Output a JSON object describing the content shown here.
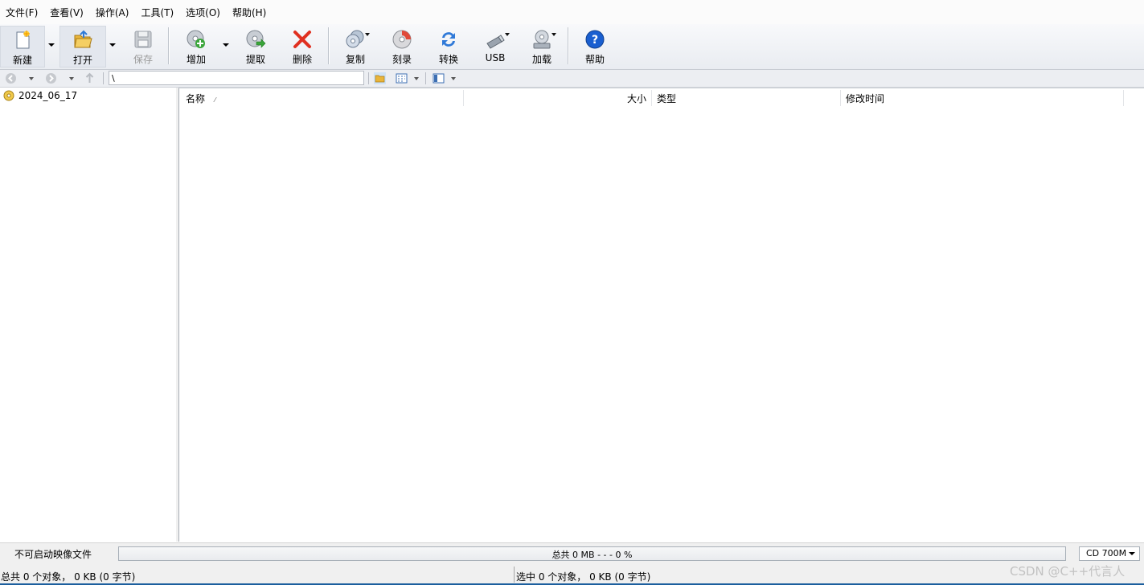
{
  "menu": [
    "文件(F)",
    "查看(V)",
    "操作(A)",
    "工具(T)",
    "选项(O)",
    "帮助(H)"
  ],
  "toolbar": {
    "new": "新建",
    "open": "打开",
    "save": "保存",
    "add": "增加",
    "extract": "提取",
    "delete": "删除",
    "copy": "复制",
    "burn": "刻录",
    "convert": "转换",
    "usb": "USB",
    "mount": "加载",
    "help": "帮助"
  },
  "address": {
    "path": "\\"
  },
  "tree": {
    "root": "2024_06_17"
  },
  "columns": {
    "name": "名称",
    "size": "大小",
    "type": "类型",
    "modified": "修改时间"
  },
  "statusbar": {
    "bootable": "不可启动映像文件",
    "capacity_text": "总共  0 MB   - - -  0 %",
    "capacity_fraction": 0,
    "media": "CD 700M",
    "total": "总共 0 个对象，  0 KB (0 字节)",
    "selected": "选中 0 个对象，  0 KB (0 字节)"
  },
  "watermark": "CSDN @C++代言人",
  "colors": {
    "accent": "#1c5f9e",
    "delete_red": "#e03020",
    "help_blue": "#1a5fd0",
    "add_green": "#3aa53a"
  },
  "icons": {
    "new": "new-document-icon",
    "open": "open-folder-icon",
    "save": "floppy-disk-icon",
    "add": "disc-add-icon",
    "extract": "disc-extract-icon",
    "delete": "red-x-icon",
    "copy": "copy-disc-icon",
    "burn": "burn-disc-icon",
    "convert": "convert-arrows-icon",
    "usb": "usb-drive-icon",
    "mount": "mount-disc-icon",
    "help": "help-question-icon"
  }
}
